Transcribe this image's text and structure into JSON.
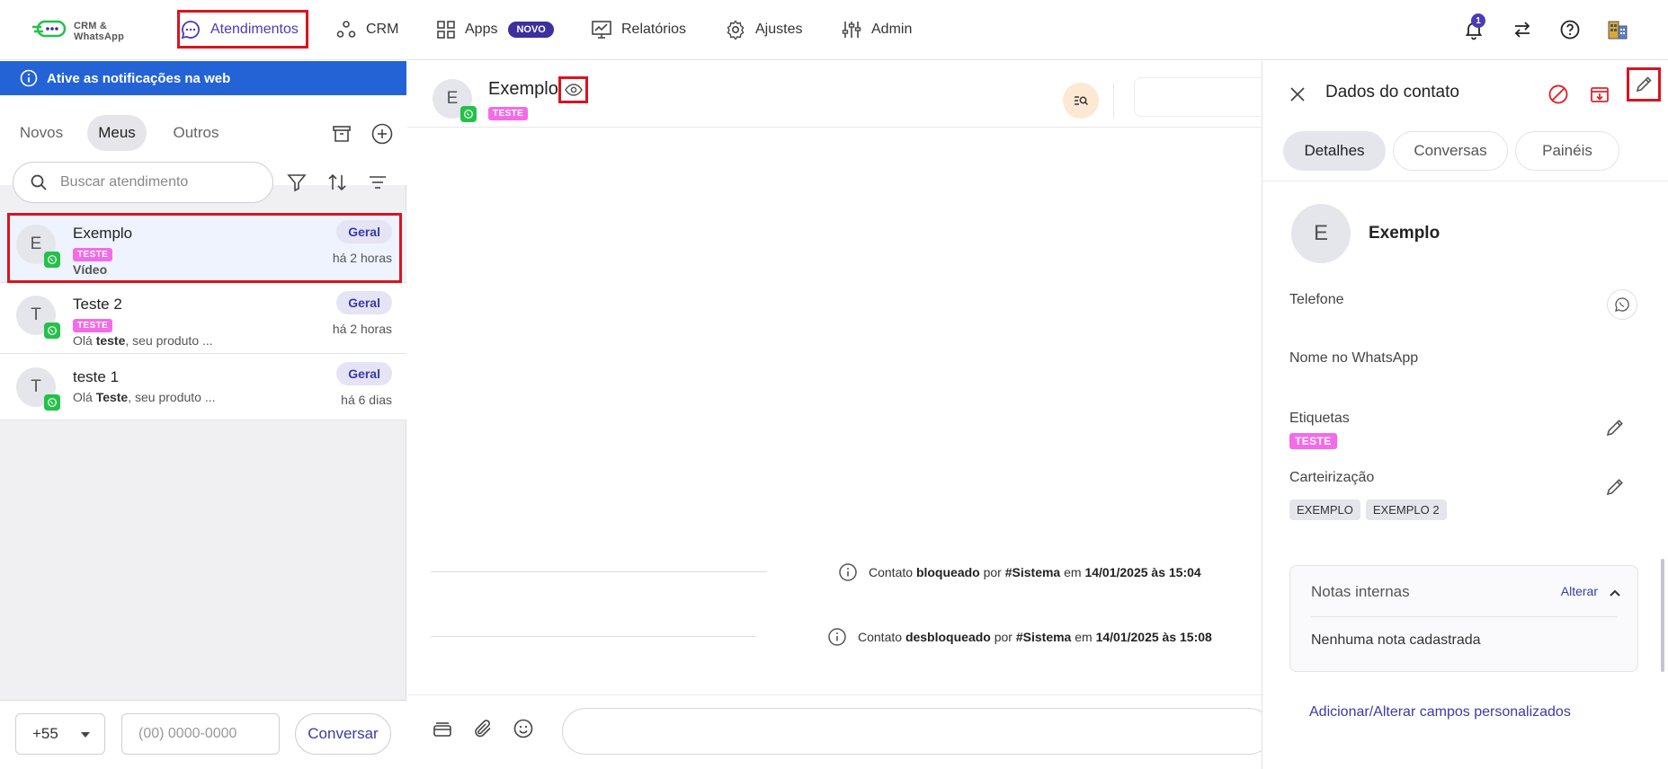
{
  "logo": {
    "line1": "CRM &",
    "line2": "WhatsApp"
  },
  "nav": {
    "atendimentos": "Atendimentos",
    "crm": "CRM",
    "apps": "Apps",
    "apps_badge": "NOVO",
    "relatorios": "Relatórios",
    "ajustes": "Ajustes",
    "admin": "Admin",
    "notification_count": "1"
  },
  "banner": {
    "text": "Ative as notificações na web"
  },
  "tabs": [
    "Novos",
    "Meus",
    "Outros"
  ],
  "active_tab": "Meus",
  "search": {
    "placeholder": "Buscar atendimento"
  },
  "conversations": [
    {
      "initial": "E",
      "name": "Exemplo",
      "tag": "TESTE",
      "preview": "Vídeo",
      "preview_bold": "",
      "queue": "Geral",
      "time": "há 2 horas",
      "selected": true
    },
    {
      "initial": "T",
      "name": "Teste 2",
      "tag": "TESTE",
      "preview_prefix": "Olá ",
      "preview_bold": "teste",
      "preview_suffix": ", seu produto ...",
      "queue": "Geral",
      "time": "há 2 horas"
    },
    {
      "initial": "T",
      "name": "teste 1",
      "tag": "",
      "preview_prefix": "Olá ",
      "preview_bold": "Teste",
      "preview_suffix": ", seu produto ...",
      "queue": "Geral",
      "time": "há 6 dias"
    }
  ],
  "new_chat": {
    "ddi": "+55",
    "phone_placeholder": "(00) 0000-0000",
    "button": "Conversar"
  },
  "chat": {
    "initial": "E",
    "name": "Exemplo",
    "tag": "TESTE",
    "events": [
      {
        "prefix": "Contato ",
        "action": "bloqueado",
        "by": " por ",
        "actor": "#Sistema",
        "at": " em ",
        "when": "14/01/2025 às 15:04"
      },
      {
        "prefix": "Contato ",
        "action": "desbloqueado",
        "by": " por ",
        "actor": "#Sistema",
        "at": " em ",
        "when": "14/01/2025 às 15:08"
      }
    ]
  },
  "contact_panel": {
    "title": "Dados do contato",
    "tabs": [
      "Detalhes",
      "Conversas",
      "Painéis"
    ],
    "active_tab": "Detalhes",
    "initial": "E",
    "name": "Exemplo",
    "phone_label": "Telefone",
    "whatsapp_name_label": "Nome no WhatsApp",
    "labels_label": "Etiquetas",
    "labels": [
      "TESTE"
    ],
    "portfolio_label": "Carteirização",
    "portfolio": [
      "EXEMPLO",
      "EXEMPLO 2"
    ],
    "notes_title": "Notas internas",
    "notes_action": "Alterar",
    "notes_empty": "Nenhuma nota cadastrada",
    "custom_fields_link": "Adicionar/Alterar campos personalizados"
  },
  "colors": {
    "brand": "#3c2f9e",
    "accent": "#4a3bb5",
    "banner": "#2463d6",
    "tag_pink": "#f46be8",
    "whatsapp": "#25c04a",
    "highlight": "#d9141f",
    "danger": "#e0262f"
  }
}
